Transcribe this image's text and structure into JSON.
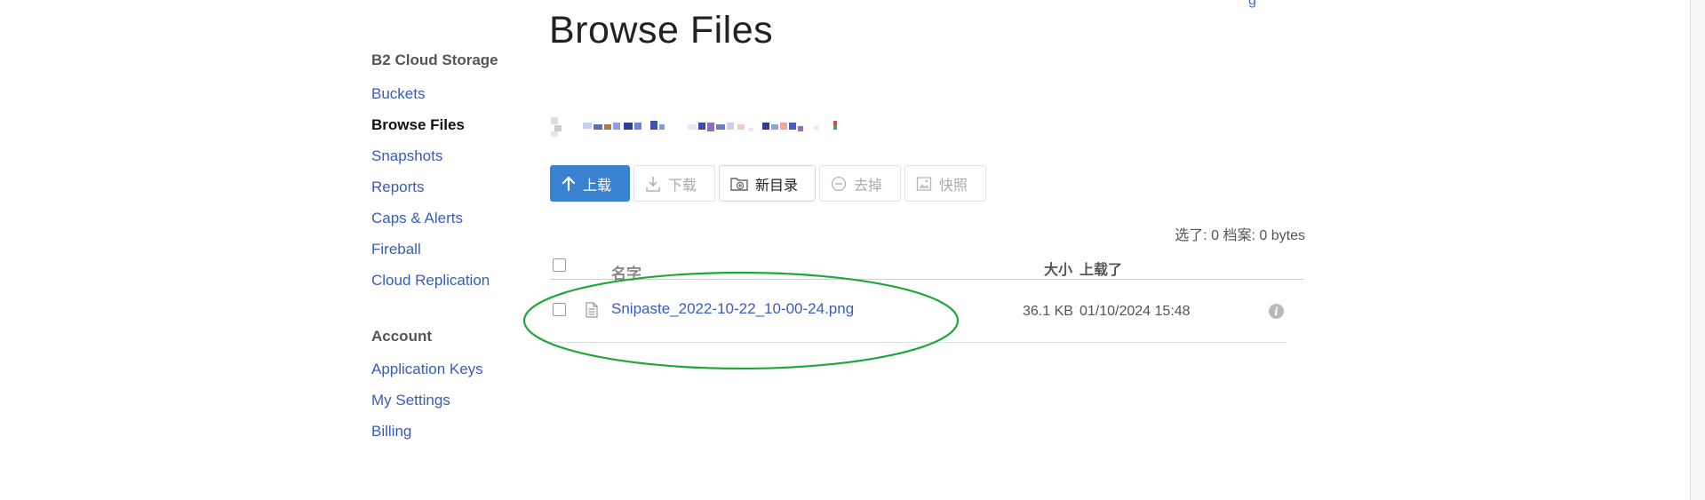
{
  "page": {
    "title": "Browse Files",
    "top_link_fragment": "g"
  },
  "sidebar": {
    "storage_heading": "B2 Cloud Storage",
    "storage_items": [
      {
        "label": "Buckets",
        "active": false
      },
      {
        "label": "Browse Files",
        "active": true
      },
      {
        "label": "Snapshots",
        "active": false
      },
      {
        "label": "Reports",
        "active": false
      },
      {
        "label": "Caps & Alerts",
        "active": false
      },
      {
        "label": "Fireball",
        "active": false
      },
      {
        "label": "Cloud Replication",
        "active": false
      }
    ],
    "account_heading": "Account",
    "account_items": [
      {
        "label": "Application Keys"
      },
      {
        "label": "My Settings"
      },
      {
        "label": "Billing"
      }
    ]
  },
  "toolbar": {
    "upload_label": "上载",
    "download_label": "下载",
    "new_folder_label": "新目录",
    "delete_label": "去掉",
    "snapshot_label": "快照"
  },
  "selection_summary": "选了: 0 档案: 0 bytes",
  "table": {
    "columns": {
      "name": "名字",
      "size": "大小",
      "uploaded": "上载了"
    },
    "rows": [
      {
        "name": "Snipaste_2022-10-22_10-00-24.png",
        "size": "36.1 KB",
        "uploaded": "01/10/2024 15:48"
      }
    ]
  },
  "colors": {
    "primary": "#3b82d1",
    "link": "#3a5cb8",
    "highlight_annotation": "#1fa83a"
  },
  "icons": [
    "upload-icon",
    "download-icon",
    "new-folder-icon",
    "delete-icon",
    "snapshot-icon",
    "file-icon",
    "info-icon"
  ]
}
